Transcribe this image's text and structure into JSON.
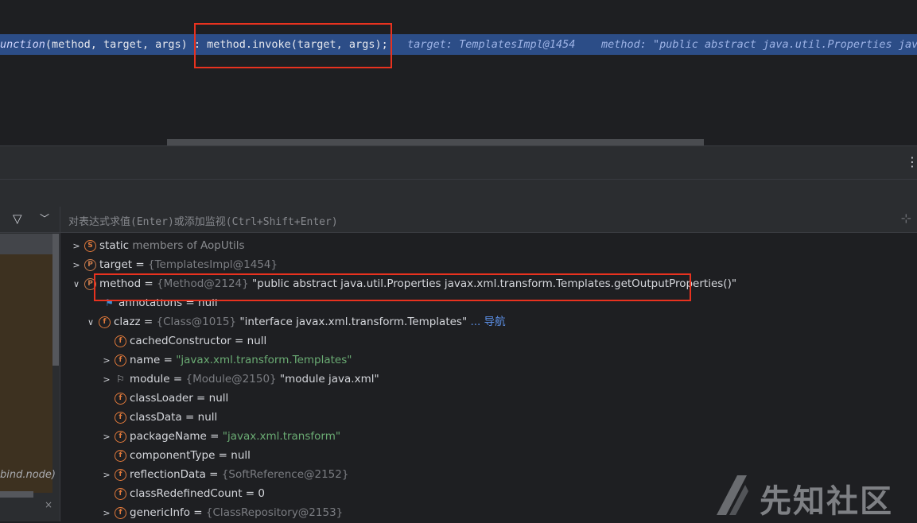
{
  "editor": {
    "exec_line": {
      "fn_prefix": "unction",
      "fn_args": "(method, target, args) ",
      "separator": ":",
      "invoke_call": "method.invoke(target, args);",
      "hint_target": "target: TemplatesImpl@1454",
      "hint_method": "method: \"public abstract java.util.Properties javax."
    },
    "fragment": "..."
  },
  "toolbar": {
    "more_icon": "more-vertical-icon"
  },
  "frames": {
    "frame_label": "bind.node)",
    "close_glyph": "×"
  },
  "variables": {
    "eval_placeholder": "对表达式求值(Enter)或添加监视(Ctrl+Shift+Enter)",
    "rows": [
      {
        "name": "static members of AopUtils",
        "prefix": "static",
        "rest": " members of AopUtils",
        "icon": "S"
      },
      {
        "name": "target",
        "eq": " = ",
        "ref": "{TemplatesImpl@1454}",
        "icon": "P"
      },
      {
        "name": "method",
        "eq": " = ",
        "ref": "{Method@2124}",
        "str": " \"public abstract java.util.Properties javax.xml.transform.Templates.getOutputProperties()\"",
        "icon": "P"
      },
      {
        "name": "annotations",
        "eq": " = ",
        "val": "null"
      },
      {
        "name": "clazz",
        "eq": " = ",
        "ref": "{Class@1015}",
        "str": " \"interface javax.xml.transform.Templates\"",
        "link": " ... 导航",
        "icon": "f"
      },
      {
        "name": "cachedConstructor",
        "eq": " = ",
        "val": "null",
        "icon": "f"
      },
      {
        "name": "name",
        "eq": " = ",
        "str": "\"javax.xml.transform.Templates\"",
        "icon": "f"
      },
      {
        "name": "module",
        "eq": " = ",
        "ref": "{Module@2150}",
        "str2": " \"module java.xml\""
      },
      {
        "name": "classLoader",
        "eq": " = ",
        "val": "null",
        "icon": "f"
      },
      {
        "name": "classData",
        "eq": " = ",
        "val": "null",
        "icon": "f"
      },
      {
        "name": "packageName",
        "eq": " = ",
        "str": "\"javax.xml.transform\"",
        "icon": "f"
      },
      {
        "name": "componentType",
        "eq": " = ",
        "val": "null",
        "icon": "f"
      },
      {
        "name": "reflectionData",
        "eq": " = ",
        "ref": "{SoftReference@2152}",
        "icon": "f"
      },
      {
        "name": "classRedefinedCount",
        "eq": " = ",
        "val": "0",
        "icon": "f"
      },
      {
        "name": "genericInfo",
        "eq": " = ",
        "ref": "{ClassRepository@2153}",
        "icon": "f"
      }
    ]
  },
  "watermark": {
    "text": "先知社区"
  },
  "colors": {
    "exec_highlight": "#2c4d87",
    "annotation_box": "#e8321f",
    "string_value": "#6aab73",
    "field_icon": "#e0793b"
  }
}
